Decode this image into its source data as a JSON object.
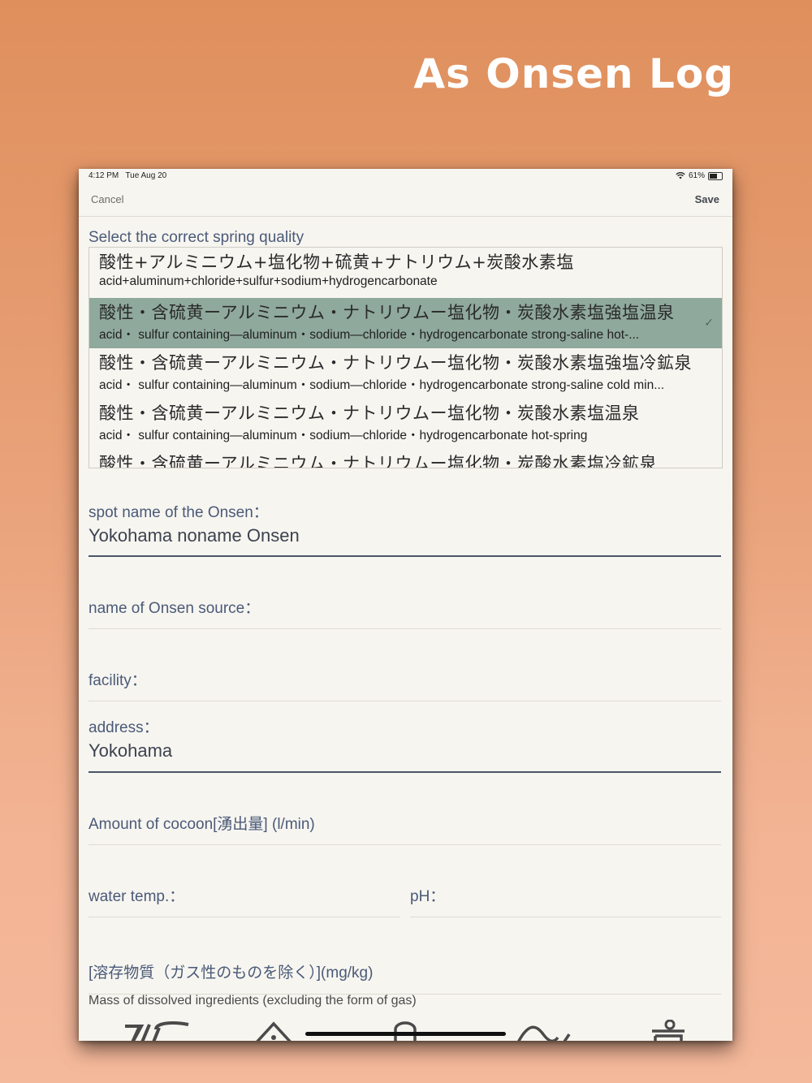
{
  "headline": "As Onsen Log",
  "status": {
    "time": "4:12 PM",
    "date": "Tue Aug 20",
    "battery": "61%",
    "battery_level": 0.61
  },
  "nav": {
    "cancel": "Cancel",
    "save": "Save"
  },
  "section_title": "Select the correct spring quality",
  "picker": {
    "items": [
      {
        "jp": "酸性+アルミニウム+塩化物+硫黄+ナトリウム+炭酸水素塩",
        "en": "acid+aluminum+chloride+sulfur+sodium+hydrogencarbonate"
      },
      {
        "jp": "酸性・含硫黄ーアルミニウム・ナトリウムー塩化物・炭酸水素塩強塩温泉",
        "en": "acid・ sulfur containing—aluminum・sodium—chloride・hydrogencarbonate strong-saline hot-...",
        "check": "✓"
      },
      {
        "jp": "酸性・含硫黄ーアルミニウム・ナトリウムー塩化物・炭酸水素塩強塩冷鉱泉",
        "en": "acid・ sulfur containing—aluminum・sodium—chloride・hydrogencarbonate strong-saline cold min..."
      },
      {
        "jp": "酸性・含硫黄ーアルミニウム・ナトリウムー塩化物・炭酸水素塩温泉",
        "en": "acid・ sulfur containing—aluminum・sodium—chloride・hydrogencarbonate hot-spring"
      },
      {
        "jp": "酸性・含硫黄ーアルミニウム・ナトリウムー塩化物・炭酸水素塩冷鉱泉",
        "en": ""
      }
    ]
  },
  "fields": {
    "spot_name": {
      "label": "spot name of the Onsen：",
      "value": "Yokohama noname Onsen"
    },
    "source": {
      "label": "name of Onsen source：",
      "value": ""
    },
    "facility": {
      "label": "facility：",
      "value": ""
    },
    "address": {
      "label": "address：",
      "value": "Yokohama"
    },
    "amount": {
      "label": "Amount of cocoon[湧出量] (l/min)",
      "value": ""
    },
    "water_temp": {
      "label": "water temp.：",
      "value": ""
    },
    "ph": {
      "label": "pH：",
      "value": ""
    },
    "dissolved": {
      "label": "[溶存物質（ガス性のものを除く）](mg/kg)",
      "sublabel": "Mass of dissolved ingredients (excluding the form of gas)"
    }
  },
  "tabbar": {
    "icons": [
      "onsen-logo-icon",
      "mountain-icon",
      "bottle-icon",
      "wave-icon",
      "bath-icon"
    ]
  }
}
